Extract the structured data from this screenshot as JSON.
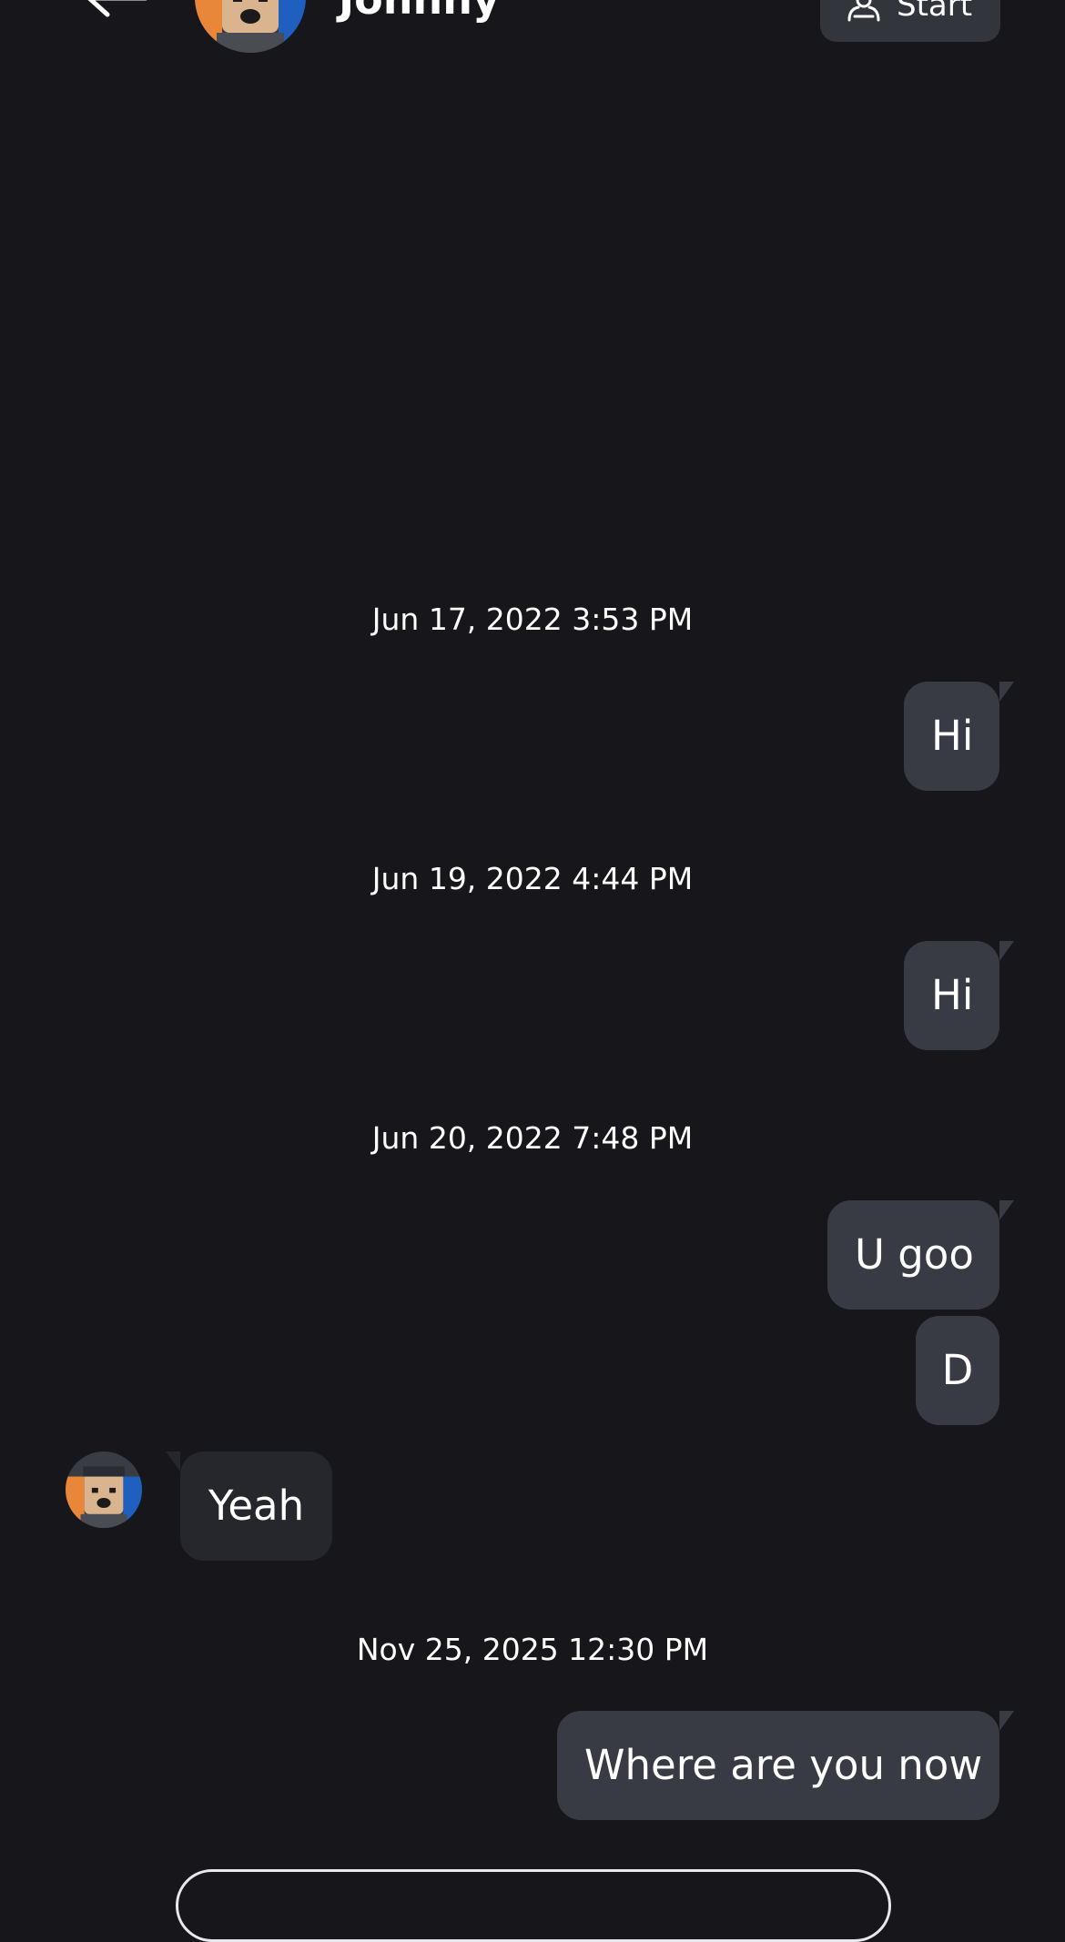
{
  "colors": {
    "background": "#17171b",
    "outgoing_bubble": "#393b44",
    "incoming_bubble": "#25272c",
    "button_bg": "#33353d",
    "text": "#ffffff"
  },
  "header": {
    "back_icon": "arrow-left-icon",
    "contact_name": "Johnny",
    "start_button": {
      "icon": "party-icon",
      "label": "Start"
    }
  },
  "messages": [
    {
      "kind": "timestamp",
      "text": "Jun 17, 2022 3:53 PM"
    },
    {
      "kind": "outgoing",
      "text": "Hi"
    },
    {
      "kind": "timestamp",
      "text": "Jun 19, 2022 4:44 PM"
    },
    {
      "kind": "outgoing",
      "text": "Hi"
    },
    {
      "kind": "timestamp",
      "text": "Jun 20, 2022 7:48 PM"
    },
    {
      "kind": "outgoing",
      "text": "U goo"
    },
    {
      "kind": "outgoing",
      "text": "D"
    },
    {
      "kind": "incoming",
      "text": "Yeah"
    },
    {
      "kind": "timestamp",
      "text": "Nov 25, 2025 12:30 PM"
    },
    {
      "kind": "outgoing",
      "text": "Where are you now"
    }
  ],
  "composer": {
    "placeholder": ""
  }
}
